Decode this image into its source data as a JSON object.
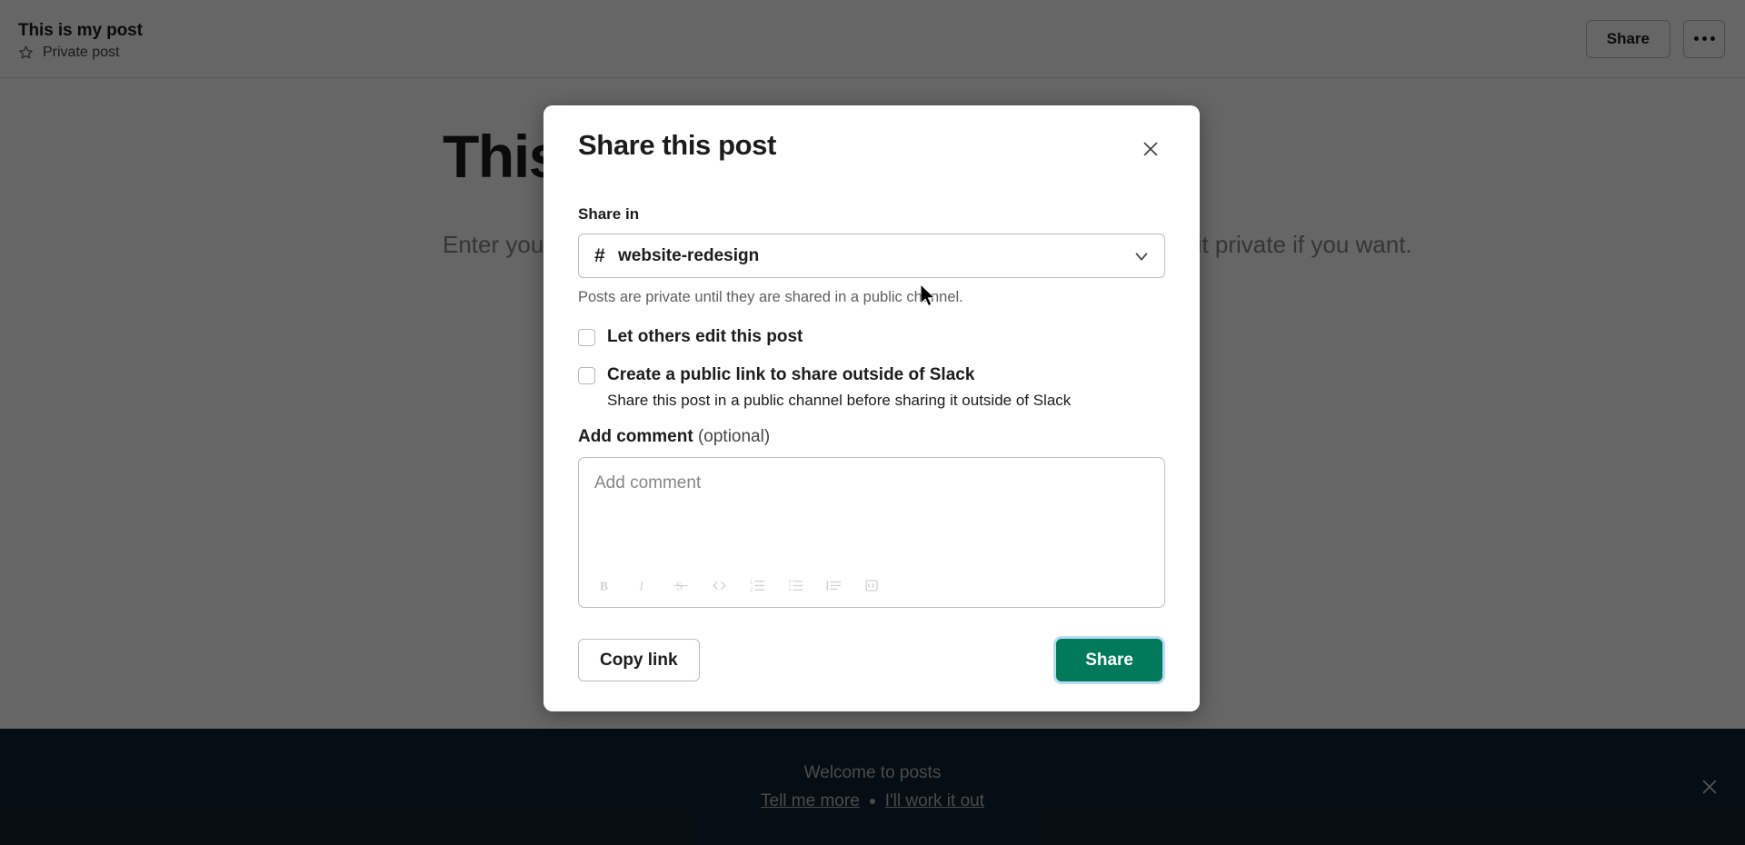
{
  "header": {
    "post_title": "This is my post",
    "visibility_label": "Private post",
    "star_icon": "star-icon",
    "share_label": "Share",
    "overflow_icon": "ellipsis-icon"
  },
  "background_page": {
    "doc_title": "This",
    "doc_placeholder": "Enter your text or type / for shortcuts. Share when you're ready, or keep it private if you want."
  },
  "modal": {
    "title": "Share this post",
    "close_icon": "close-icon",
    "share_in": {
      "label": "Share in",
      "hash_icon": "hash-icon",
      "selected_channel": "website-redesign",
      "chevron_icon": "chevron-down-icon"
    },
    "helper_text": "Posts are private until they are shared in a public channel.",
    "checkboxes": [
      {
        "label": "Let others edit this post",
        "checked": false,
        "sub": ""
      },
      {
        "label": "Create a public link to share outside of Slack",
        "checked": false,
        "sub": "Share this post in a public channel before sharing it outside of Slack"
      }
    ],
    "comment": {
      "label_bold": "Add comment",
      "label_optional": " (optional)",
      "placeholder": "Add comment",
      "toolbar": [
        {
          "name": "bold-icon",
          "label": "B"
        },
        {
          "name": "italic-icon",
          "label": "I"
        },
        {
          "name": "strikethrough-icon",
          "label": "S"
        },
        {
          "name": "code-icon",
          "label": "</>"
        },
        {
          "name": "ordered-list-icon",
          "label": "1."
        },
        {
          "name": "bulleted-list-icon",
          "label": "•"
        },
        {
          "name": "blockquote-icon",
          "label": "“"
        },
        {
          "name": "code-block-icon",
          "label": "{}"
        }
      ]
    },
    "footer": {
      "copy_link_label": "Copy link",
      "share_label": "Share"
    }
  },
  "banner": {
    "title": "Welcome to posts",
    "link_primary": "Tell me more",
    "separator": "•",
    "link_secondary": "I'll work it out",
    "close_icon": "close-icon"
  },
  "colors": {
    "primary_green": "#007a5a",
    "focus_ring": "#b9dcf5",
    "banner_bg": "#0e2433",
    "overlay": "rgba(0,0,0,0.6)"
  }
}
